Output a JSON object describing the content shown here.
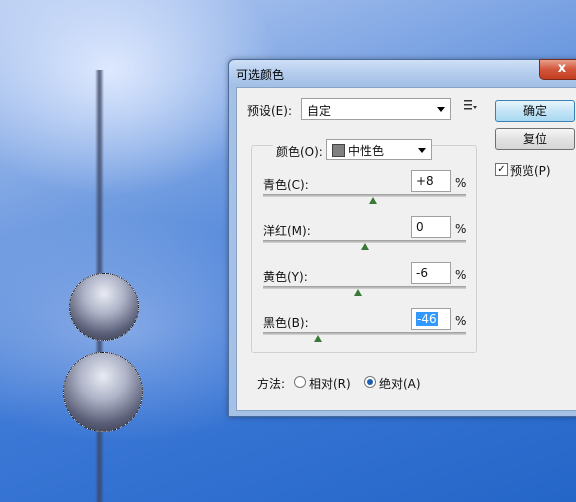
{
  "window": {
    "title": "可选颜色",
    "close_glyph": "x"
  },
  "preset": {
    "label": "预设(E):",
    "value": "自定"
  },
  "buttons": {
    "ok": "确定",
    "reset": "复位"
  },
  "preview": {
    "label": "预览(P)",
    "checked": true
  },
  "colors": {
    "label": "颜色(O):",
    "value": "中性色"
  },
  "sliders": [
    {
      "label": "青色(C):",
      "value": "+8",
      "unit": "%",
      "level": 8
    },
    {
      "label": "洋红(M):",
      "value": "0",
      "unit": "%",
      "level": 0
    },
    {
      "label": "黄色(Y):",
      "value": "-6",
      "unit": "%",
      "level": -6
    },
    {
      "label": "黑色(B):",
      "value": "-46",
      "unit": "%",
      "level": -46,
      "selected": true
    }
  ],
  "method": {
    "label": "方法:",
    "options": [
      {
        "label": "相对(R)",
        "checked": false
      },
      {
        "label": "绝对(A)",
        "checked": true
      }
    ]
  }
}
